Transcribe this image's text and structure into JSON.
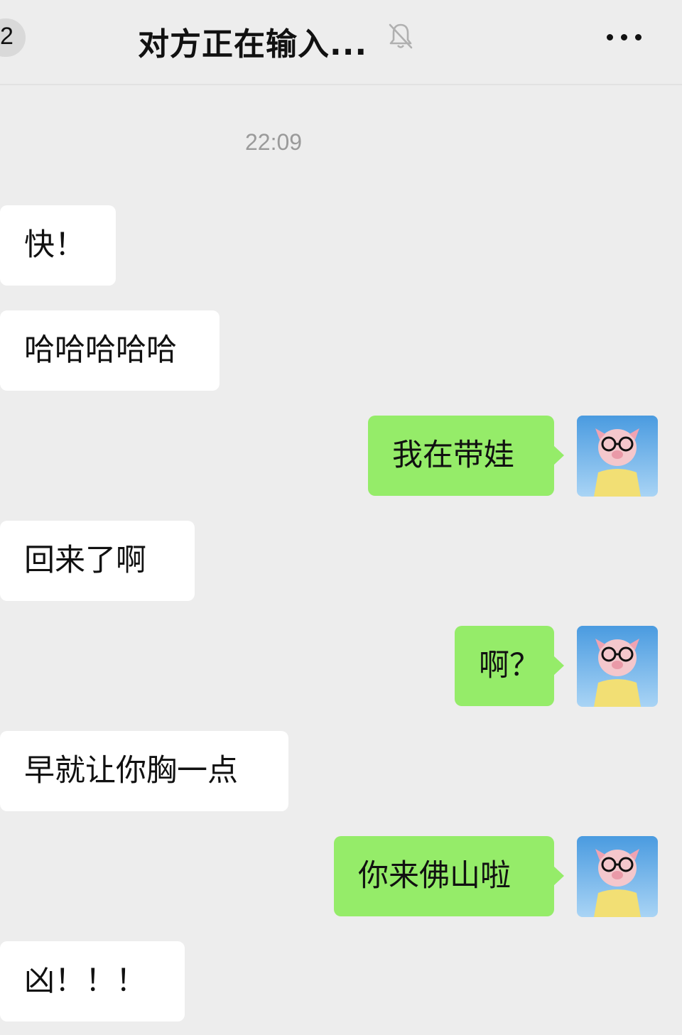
{
  "header": {
    "back_count": "2",
    "title": "对方正在输入...",
    "mute_icon": "bell-off-icon",
    "more_icon": "more-dots-icon"
  },
  "timestamp": "22:09",
  "messages": [
    {
      "side": "in",
      "text": "快！"
    },
    {
      "side": "in",
      "text": "哈哈哈哈哈"
    },
    {
      "side": "out",
      "text": "我在带娃"
    },
    {
      "side": "in",
      "text": "回来了啊"
    },
    {
      "side": "out",
      "text": "啊？"
    },
    {
      "side": "in",
      "text": "早就让你胸一点"
    },
    {
      "side": "out",
      "text": "你来佛山啦"
    },
    {
      "side": "in",
      "text": "凶！！！"
    }
  ],
  "colors": {
    "background": "#ededed",
    "incoming_bubble": "#ffffff",
    "outgoing_bubble": "#95ec69",
    "timestamp": "#9a9a9a"
  }
}
